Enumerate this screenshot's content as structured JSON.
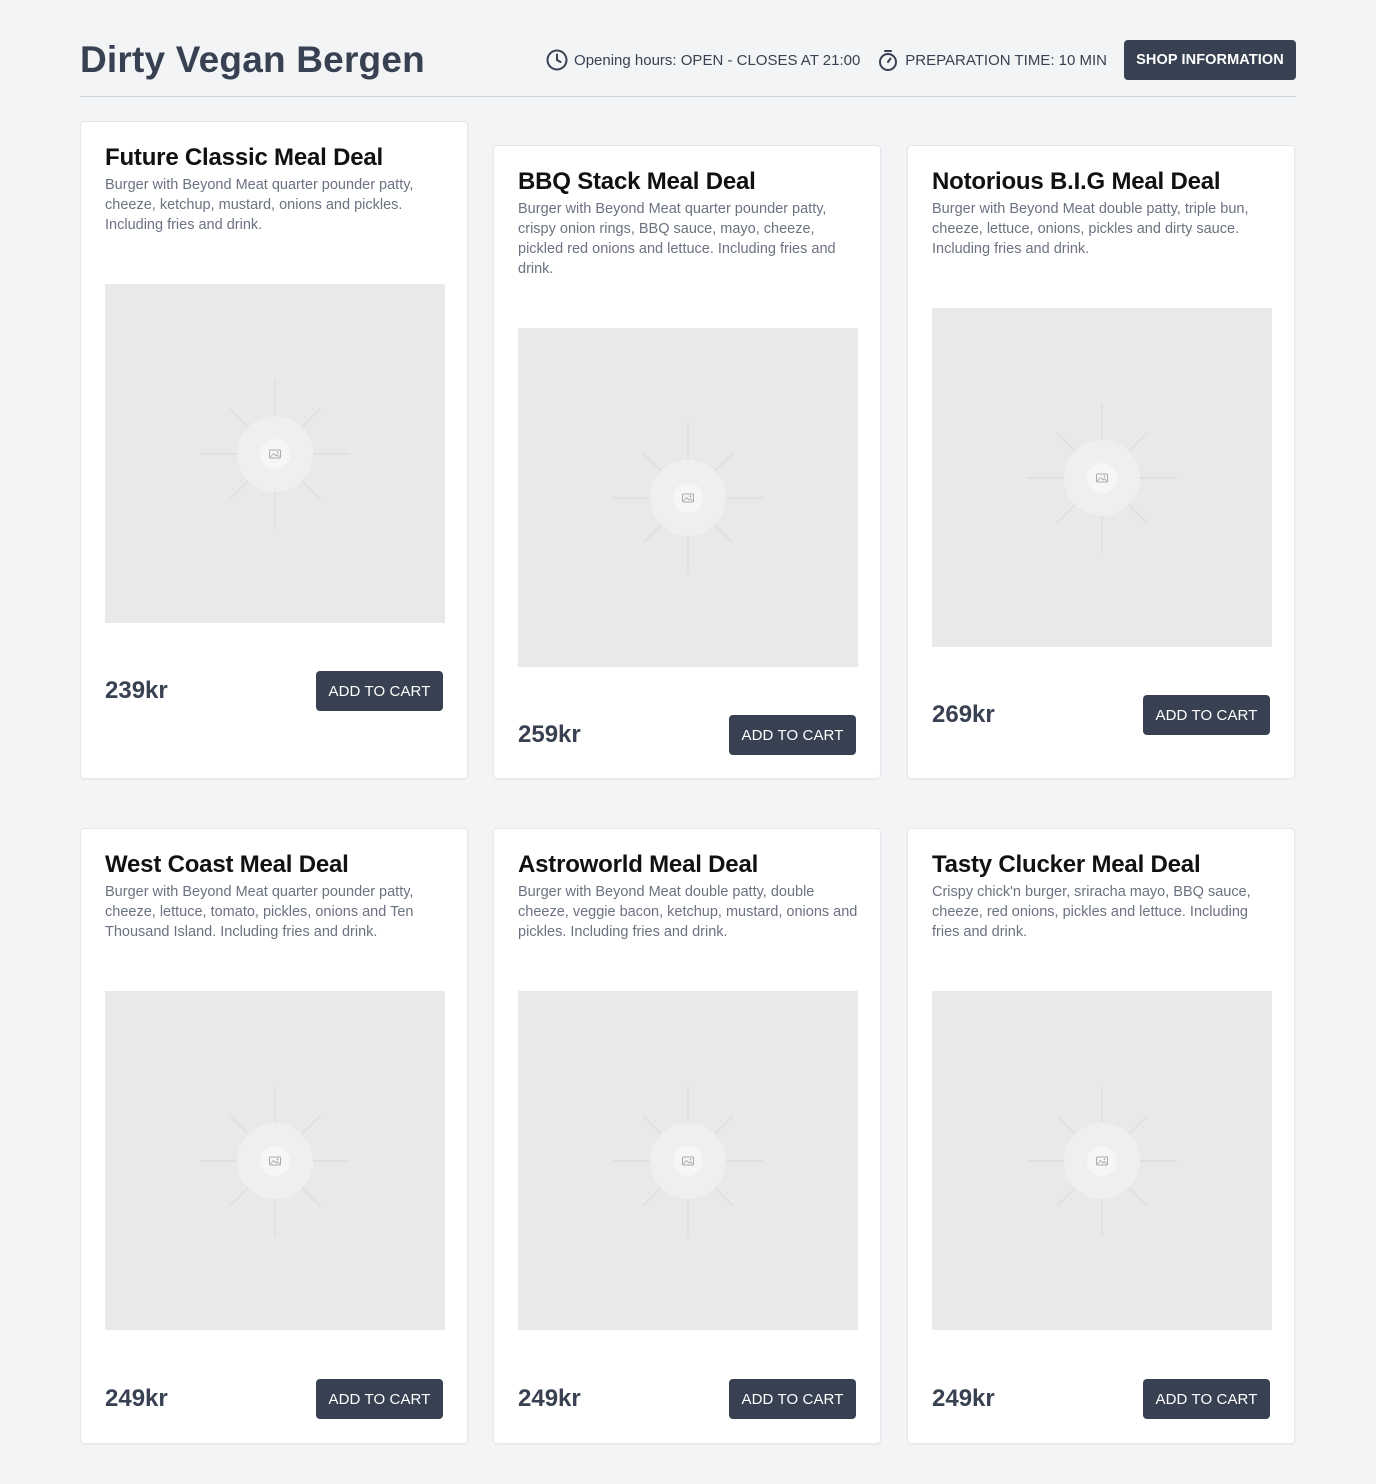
{
  "header": {
    "title": "Dirty Vegan Bergen",
    "opening_hours": "Opening hours: OPEN - CLOSES AT 21:00",
    "prep_time": "PREPARATION TIME: 10 MIN",
    "shop_info_label": "SHOP INFORMATION"
  },
  "products": [
    {
      "title": "Future Classic Meal Deal",
      "description": "Burger with Beyond Meat quarter pounder patty, cheeze, ketchup, mustard, onions and pickles. Including fries and drink.",
      "price": "239kr",
      "cart_label": "ADD TO CART",
      "image_icon": "image-placeholder-icon"
    },
    {
      "title": "BBQ Stack Meal Deal",
      "description": "Burger with Beyond Meat quarter pounder patty, crispy onion rings, BBQ sauce, mayo, cheeze, pickled red onions and lettuce. Including fries and drink.",
      "price": "259kr",
      "cart_label": "ADD TO CART",
      "image_icon": "image-placeholder-icon"
    },
    {
      "title": "Notorious B.I.G Meal Deal",
      "description": "Burger with Beyond Meat double patty, triple bun, cheeze, lettuce, onions, pickles and dirty sauce. Including fries and drink.",
      "price": "269kr",
      "cart_label": "ADD TO CART",
      "image_icon": "image-placeholder-icon"
    },
    {
      "title": "West Coast Meal Deal",
      "description": "Burger with Beyond Meat quarter pounder patty, cheeze, lettuce, tomato, pickles, onions and Ten Thousand Island. Including fries and drink.",
      "price": "249kr",
      "cart_label": "ADD TO CART",
      "image_icon": "image-placeholder-icon"
    },
    {
      "title": "Astroworld Meal Deal",
      "description": "Burger with Beyond Meat double patty, double cheeze, veggie bacon, ketchup, mustard, onions and pickles. Including fries and drink.",
      "price": "249kr",
      "cart_label": "ADD TO CART",
      "image_icon": "image-placeholder-icon"
    },
    {
      "title": "Tasty Clucker Meal Deal",
      "description": "Crispy chick'n burger, sriracha mayo, BBQ sauce, cheeze, red onions, pickles and lettuce. Including fries and drink.",
      "price": "249kr",
      "cart_label": "ADD TO CART",
      "image_icon": "image-placeholder-icon"
    }
  ],
  "colors": {
    "background": "#f3f4f6",
    "primary_button": "#374151",
    "card_background": "#ffffff",
    "image_placeholder": "#e9e9e9",
    "muted_text": "#6b7280"
  }
}
